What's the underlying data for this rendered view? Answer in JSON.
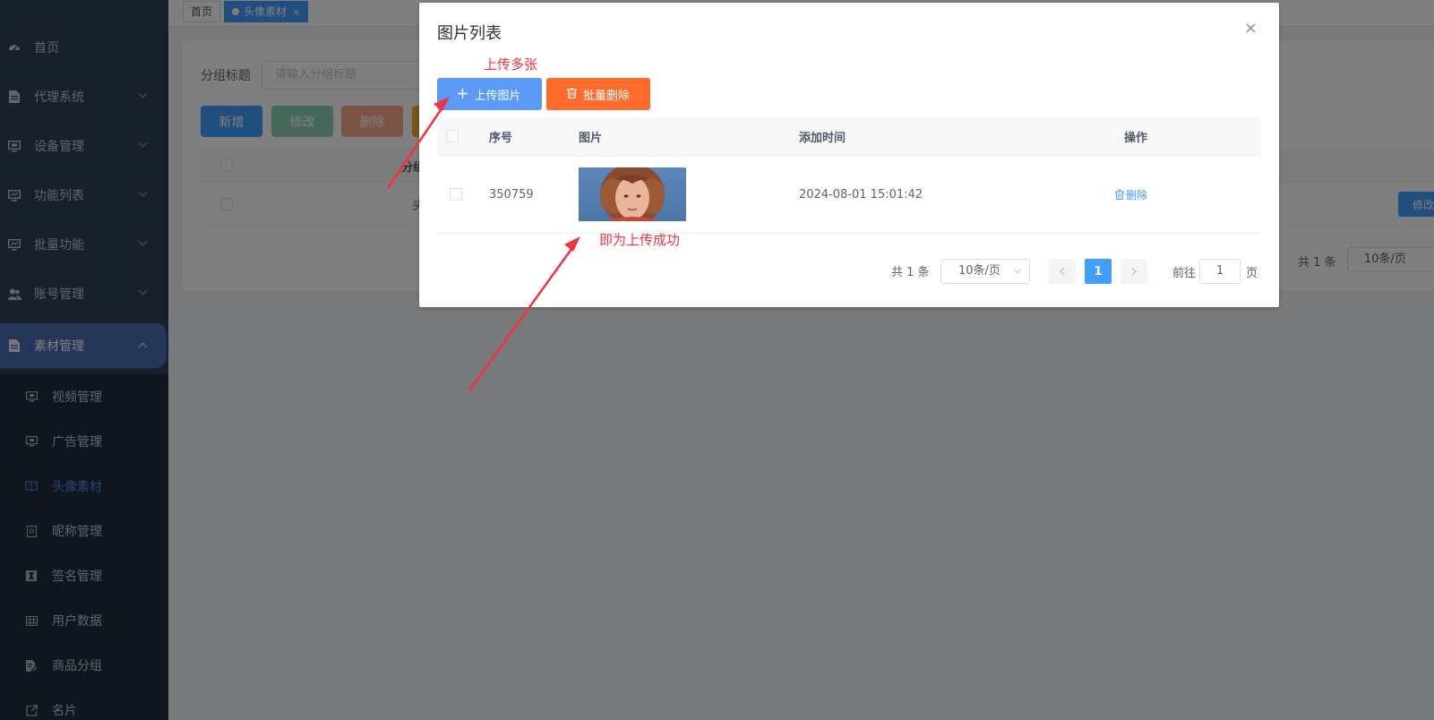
{
  "sidebar": {
    "items": [
      {
        "label": "首页",
        "icon": "dashboard-icon",
        "has_arrow": false
      },
      {
        "label": "代理系统",
        "icon": "document-icon",
        "has_arrow": true
      },
      {
        "label": "设备管理",
        "icon": "monitor-icon",
        "has_arrow": true
      },
      {
        "label": "功能列表",
        "icon": "chart-monitor-icon",
        "has_arrow": true
      },
      {
        "label": "批量功能",
        "icon": "chart-monitor-icon",
        "has_arrow": true
      },
      {
        "label": "账号管理",
        "icon": "users-icon",
        "has_arrow": true
      },
      {
        "label": "素材管理",
        "icon": "document-icon",
        "has_arrow": true,
        "open": true
      }
    ],
    "submenu": [
      {
        "label": "视频管理",
        "icon": "monitor-icon"
      },
      {
        "label": "广告管理",
        "icon": "monitor-icon"
      },
      {
        "label": "头像素材",
        "icon": "book-icon",
        "active": true
      },
      {
        "label": "昵称管理",
        "icon": "id-card-icon"
      },
      {
        "label": "签名管理",
        "icon": "text-icon"
      },
      {
        "label": "用户数据",
        "icon": "table-icon"
      },
      {
        "label": "商品分组",
        "icon": "edit-doc-icon"
      },
      {
        "label": "名片",
        "icon": "external-link-icon"
      }
    ]
  },
  "tags": {
    "home": "首页",
    "current": "头像素材",
    "close": "×"
  },
  "background": {
    "filter_label": "分组标题",
    "filter_placeholder": "请输入分组标题",
    "btn_add": "新增",
    "btn_edit": "修改",
    "btn_delete": "删除",
    "header_partial": "分组",
    "row_partial": "头",
    "row_edit": "修改",
    "pager_total": "共 1 条",
    "pager_size": "10条/页"
  },
  "dialog": {
    "title": "图片列表",
    "close": "×",
    "upload_label": "上传图片",
    "batch_delete_label": "批量删除",
    "columns": {
      "index": "序号",
      "image": "图片",
      "time": "添加时间",
      "action": "操作"
    },
    "rows": [
      {
        "index": "350759",
        "time": "2024-08-01 15:01:42",
        "action": "删除"
      }
    ],
    "pager": {
      "total": "共 1 条",
      "size": "10条/页",
      "current": "1",
      "goto_prefix": "前往",
      "goto_value": "1",
      "goto_suffix": "页"
    }
  },
  "annotations": {
    "upload_multiple": "上传多张",
    "upload_success": "即为上传成功"
  },
  "colors": {
    "primary": "#409eff",
    "upload_button": "#5b9bf7",
    "batch_delete_button": "#ff6a2d",
    "annotation": "#f5313d",
    "sidebar_bg": "#304156",
    "submenu_bg": "#1f2d3d"
  }
}
